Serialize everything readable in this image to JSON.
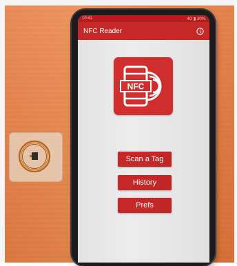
{
  "status_bar": {
    "time": "10:41",
    "indicators": "4G ▮ 30%"
  },
  "app_bar": {
    "title": "NFC Reader",
    "info_icon": "info-icon"
  },
  "logo": {
    "text": "NFC",
    "icon": "nfc-phone-icon"
  },
  "menu": {
    "scan_label": "Scan a Tag",
    "history_label": "History",
    "prefs_label": "Prefs"
  },
  "colors": {
    "primary": "#c62828",
    "primary_dark": "#b71c1c",
    "logo_bg": "#d32f2f",
    "screen_bg": "#ececec",
    "wood": "#e77e45"
  }
}
